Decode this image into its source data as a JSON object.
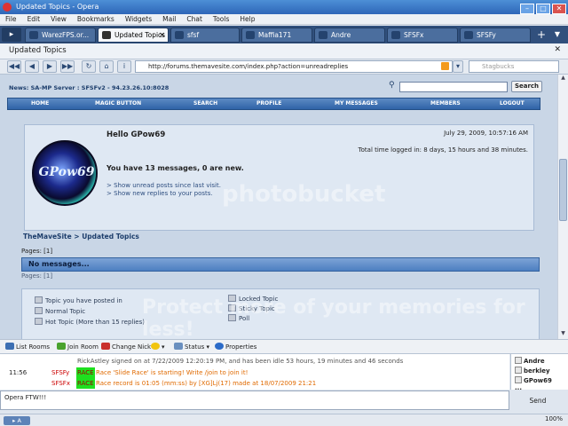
{
  "window": {
    "title": "Updated Topics - Opera",
    "controls": [
      "–",
      "□",
      "✕"
    ]
  },
  "menu": [
    "File",
    "Edit",
    "View",
    "Bookmarks",
    "Widgets",
    "Mail",
    "Chat",
    "Tools",
    "Help"
  ],
  "tabs": [
    {
      "label": "WarezFPS.or..."
    },
    {
      "label": "Updated Topics"
    },
    {
      "label": "sfsf"
    },
    {
      "label": "Maffia171"
    },
    {
      "label": "Andre"
    },
    {
      "label": "SFSFx"
    },
    {
      "label": "SFSFy"
    }
  ],
  "page": {
    "title": "Updated Topics"
  },
  "address": {
    "url": "http://forums.themavesite.com/index.php?action=unreadreplies",
    "search_placeholder": "Stagbucks"
  },
  "forum": {
    "news": "News: SA-MP Server : SFSFv2 - 94.23.26.10:8028",
    "search_button": "Search",
    "nav": [
      "HOME",
      "MAGIC BUTTON",
      "SEARCH",
      "PROFILE",
      "MY MESSAGES",
      "MEMBERS",
      "LOGOUT"
    ],
    "avatar_text": "GPow69",
    "hello": "Hello GPow69",
    "datetime": "July 29, 2009, 10:57:16 AM",
    "time_logged": "Total time logged in: 8 days, 15 hours and 38 minutes.",
    "new_messages": "You have 13 messages, 0 are new.",
    "link_unread_posts": "> Show unread posts since last visit.",
    "link_new_replies": "> Show new replies to your posts.",
    "breadcrumb": "TheMaveSite > Updated Topics",
    "pages_top": "Pages: [1]",
    "no_messages": "No messages...",
    "pages_bottom": "Pages: [1]",
    "legend": {
      "posted": "Topic you have posted in",
      "normal": "Normal Topic",
      "hot": "Hot Topic (More than 15 replies)",
      "locked": "Locked Topic",
      "sticky": "Sticky Topic",
      "poll": "Poll"
    }
  },
  "chat": {
    "toolbar": {
      "list_rooms": "List Rooms",
      "join_room": "Join Room",
      "change_nick": "Change Nick",
      "status": "Status",
      "properties": "Properties"
    },
    "messages": [
      {
        "time": "",
        "nick": "",
        "tag": "",
        "text": "RickAstley signed on at 7/22/2009 12:20:19 PM, and has been idle 53 hours, 19 minutes and 46 seconds"
      },
      {
        "time": "11:56",
        "nick": "SFSFy",
        "tag": "RACE",
        "text": "Race 'Slide Race' is starting! Write /join to join it!"
      },
      {
        "time": "",
        "nick": "SFSFx",
        "tag": "RACE",
        "text": "Race record is 01:05 (mm:ss) by [XG]Lj(17) made at 18/07/2009 21:21"
      }
    ],
    "users": [
      "Andre",
      "berkley",
      "GPow69",
      "..."
    ],
    "input_value": "Opera FTW!!!",
    "send_label": "Send"
  },
  "status": {
    "zoom": "100%"
  },
  "watermark": {
    "line1": "photobucket",
    "line2": "Protect more of your memories for less!"
  }
}
